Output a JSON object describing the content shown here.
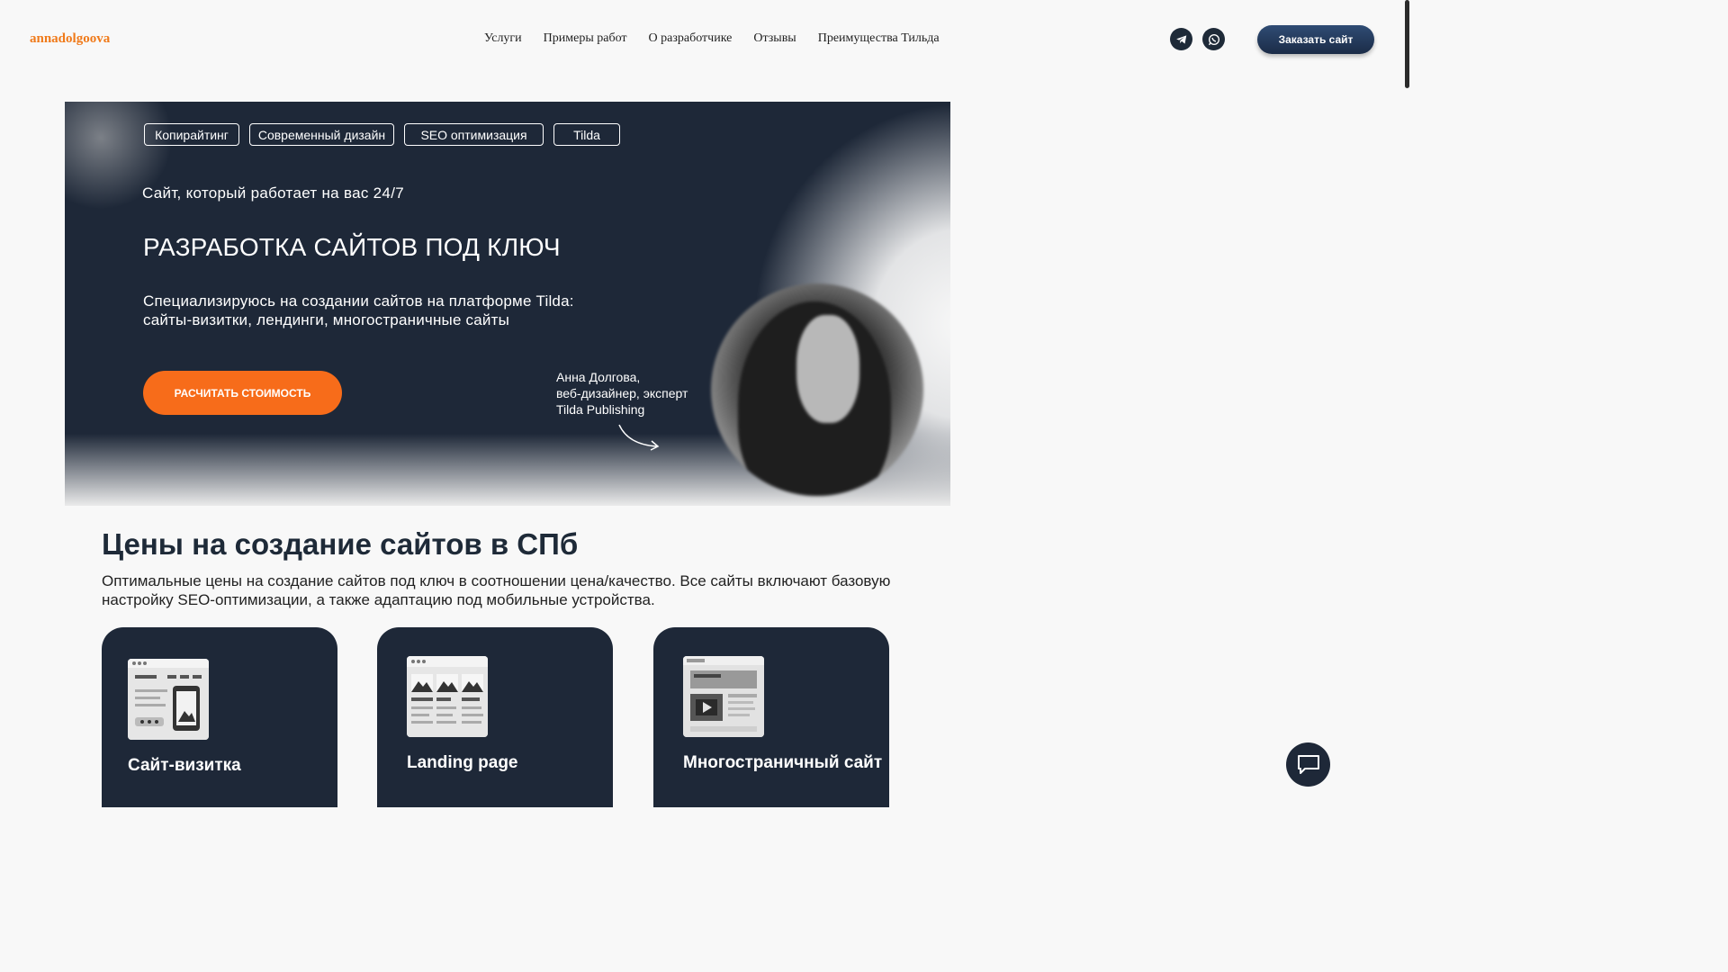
{
  "header": {
    "logo": "annadolgoova",
    "nav": [
      "Услуги",
      "Примеры работ",
      "О разработчике",
      "Отзывы",
      "Преимущества Тильда"
    ],
    "social": [
      "telegram-icon",
      "whatsapp-icon"
    ],
    "order_button": "Заказать сайт"
  },
  "hero": {
    "tags": [
      "Копирайтинг",
      "Современный дизайн",
      "SEO оптимизация",
      "Tilda"
    ],
    "subtitle": "Сайт, который работает на вас 24/7",
    "title": "РАЗРАБОТКА САЙТОВ ПОД КЛЮЧ",
    "desc_line1": "Специализируюсь на создании сайтов на платформе Tilda:",
    "desc_line2": "сайты-визитки, лендинги, многостраничные сайты",
    "cta": "РАСЧИТАТЬ СТОИМОСТЬ",
    "author_line1": "Анна Долгова,",
    "author_line2": "веб-дизайнер, эксперт",
    "author_line3": "Tilda Publishing"
  },
  "prices": {
    "title": "Цены на создание сайтов в СПб",
    "desc": "Оптимальные цены на создание сайтов под ключ в соотношении цена/качество. Все сайты включают базовую настройку SEO-оптимизации, а также адаптацию под мобильные устройства.",
    "cards": [
      {
        "name": "Сайт-визитка",
        "icon": "business-card-site-icon"
      },
      {
        "name": "Landing page",
        "icon": "landing-page-icon"
      },
      {
        "name": "Многостраничный сайт",
        "icon": "multipage-site-icon"
      }
    ]
  },
  "chat": {
    "icon": "chat-icon"
  },
  "colors": {
    "accent": "#f76c1a",
    "dark": "#1e2838",
    "logo": "#f07a1a"
  }
}
